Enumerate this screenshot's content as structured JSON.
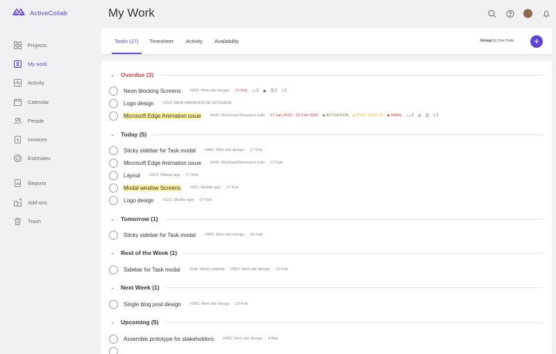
{
  "app": {
    "name": "ActiveCollab"
  },
  "page": {
    "title": "My Work"
  },
  "colors": {
    "accent": "#5b45d6",
    "overdue": "#d0403d",
    "highlight": "#fdf59c"
  },
  "sidebar": {
    "items": [
      {
        "label": "Projects",
        "icon": "grid-icon"
      },
      {
        "label": "My work",
        "icon": "person-icon",
        "active": true
      },
      {
        "label": "Activity",
        "icon": "activity-icon"
      },
      {
        "label": "Calendar",
        "icon": "calendar-icon"
      },
      {
        "label": "People",
        "icon": "people-icon"
      },
      {
        "label": "Invoices",
        "icon": "dollar-icon"
      },
      {
        "label": "Estimates",
        "icon": "target-icon"
      },
      {
        "label": "Reports",
        "icon": "report-icon"
      },
      {
        "label": "Add-ons",
        "icon": "addon-icon"
      },
      {
        "label": "Trash",
        "icon": "trash-icon"
      }
    ]
  },
  "tabs": [
    {
      "label": "Tasks (17)",
      "active": true
    },
    {
      "label": "Timesheet"
    },
    {
      "label": "Activity"
    },
    {
      "label": "Availability"
    }
  ],
  "groupby": {
    "prefix": "Group",
    "text": "by Due Date"
  },
  "add_button": "+",
  "groups": [
    {
      "title": "Overdue (3)",
      "tasks": [
        {
          "name": "Neon blocking Screens",
          "ref": "#983: Web site design",
          "date": "13 Feb",
          "comments": "2",
          "subtasks": "2",
          "files": "2"
        },
        {
          "name": "Logo design",
          "ref": "#253: NEW WAREHOUSE UPGRADE"
        },
        {
          "name": "Microsoft Edge Animation issue",
          "ref": "#646: Workload Research Edit",
          "date": "27 Jan 2020 - 15 Feb 2020",
          "labels": [
            "ACTIVATION",
            "TRIAL SIGN UP",
            "EMAIL"
          ],
          "comments": "2",
          "files": "2"
        }
      ]
    },
    {
      "title": "Today (5)",
      "tasks": [
        {
          "name": "Sticky sidebar for Task modal",
          "ref": "#983: Web site design",
          "date": "17 Feb"
        },
        {
          "name": "Microsoft Edge Animation issue",
          "ref": "#646: Workload Research Edit",
          "date": "17 Feb"
        },
        {
          "name": "Layout",
          "ref": "#321: Mobile app",
          "date": "17 Feb"
        },
        {
          "name": "Modal window Screens",
          "ref": "#321: Mobile app",
          "date": "17 Feb"
        },
        {
          "name": "Logo design",
          "ref": "#321: Mobile app",
          "date": "17 Feb"
        }
      ]
    },
    {
      "title": "Tomorrow (1)",
      "tasks": [
        {
          "name": "Sticky sidebar for Task modal",
          "ref": "#983: Web site design",
          "date": "18 Feb"
        }
      ]
    },
    {
      "title": "Rest of the Week (1)",
      "tasks": [
        {
          "name": "Sidebar for Task modal",
          "parent": "Task: Sticky sidebar",
          "ref": "#983: Web site design",
          "date": "19 Feb"
        }
      ]
    },
    {
      "title": "Next Week (1)",
      "tasks": [
        {
          "name": "Single blog post design",
          "ref": "#983: Web site design",
          "date": "22 Feb"
        }
      ]
    },
    {
      "title": "Upcoming (5)",
      "tasks": [
        {
          "name": "Assemble prototype for stakeholders",
          "ref": "#983: Web site design",
          "date": "4 Mar"
        }
      ]
    }
  ]
}
